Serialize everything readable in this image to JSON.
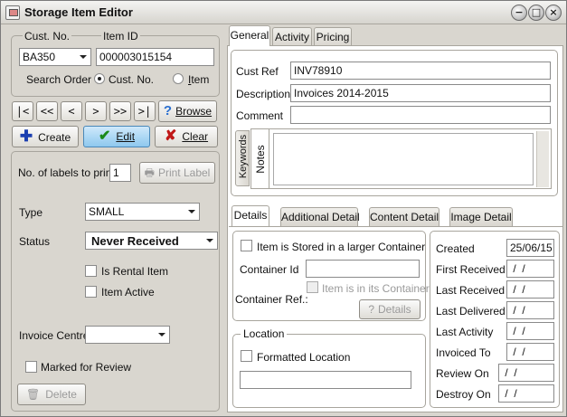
{
  "window": {
    "title": "Storage Item Editor"
  },
  "left": {
    "cust_no_label": "Cust. No.",
    "item_id_label": "Item ID",
    "cust_no_value": "BA350",
    "item_id_value": "000003015154",
    "search_order_label": "Search Order",
    "radio_custno": "Cust. No.",
    "radio_item": "Item",
    "nav": [
      "|<",
      "<<",
      "<",
      ">",
      ">>",
      ">|"
    ],
    "browse": "Browse",
    "create": "Create",
    "edit": "Edit",
    "clear": "Clear",
    "labels_to_print": "No. of labels to print",
    "labels_value": "1",
    "print_label": "Print Label",
    "type_label": "Type",
    "type_value": "SMALL",
    "status_label": "Status",
    "status_value": "Never Received",
    "rental": "Is Rental Item",
    "active": "Item Active",
    "invoice_centre": "Invoice Centre",
    "invoice_centre_value": "",
    "marked_review": "Marked for Review",
    "delete": "Delete"
  },
  "tabs_top": [
    "General",
    "Activity",
    "Pricing"
  ],
  "general": {
    "cust_ref_label": "Cust Ref",
    "cust_ref_value": "INV78910",
    "description_label": "Description",
    "description_value": "Invoices 2014-2015",
    "comment_label": "Comment",
    "comment_value": "",
    "keywords_tab": "Keywords",
    "notes_tab": "Notes"
  },
  "tabs_bottom": [
    "Details",
    "Additional Detail",
    "Content Detail",
    "Image Detail"
  ],
  "details": {
    "stored_larger": "Item is Stored in a larger Container",
    "container_id_label": "Container Id",
    "container_id_value": "",
    "in_container": "Item is in its Container",
    "container_ref_label": "Container Ref.:",
    "details_btn": "Details",
    "location_group": "Location",
    "formatted_location": "Formatted Location",
    "location_value": ""
  },
  "dates": [
    {
      "label": "Created",
      "value": "25/06/15"
    },
    {
      "label": "First Received",
      "value": " /  /"
    },
    {
      "label": "Last Received",
      "value": " /  /"
    },
    {
      "label": "Last Delivered",
      "value": " /  /"
    },
    {
      "label": "Last Activity",
      "value": " /  /"
    },
    {
      "label": "Invoiced To",
      "value": " /  /"
    },
    {
      "label": "Review On",
      "value": " /  /"
    },
    {
      "label": "Destroy On",
      "value": " /  /"
    }
  ]
}
